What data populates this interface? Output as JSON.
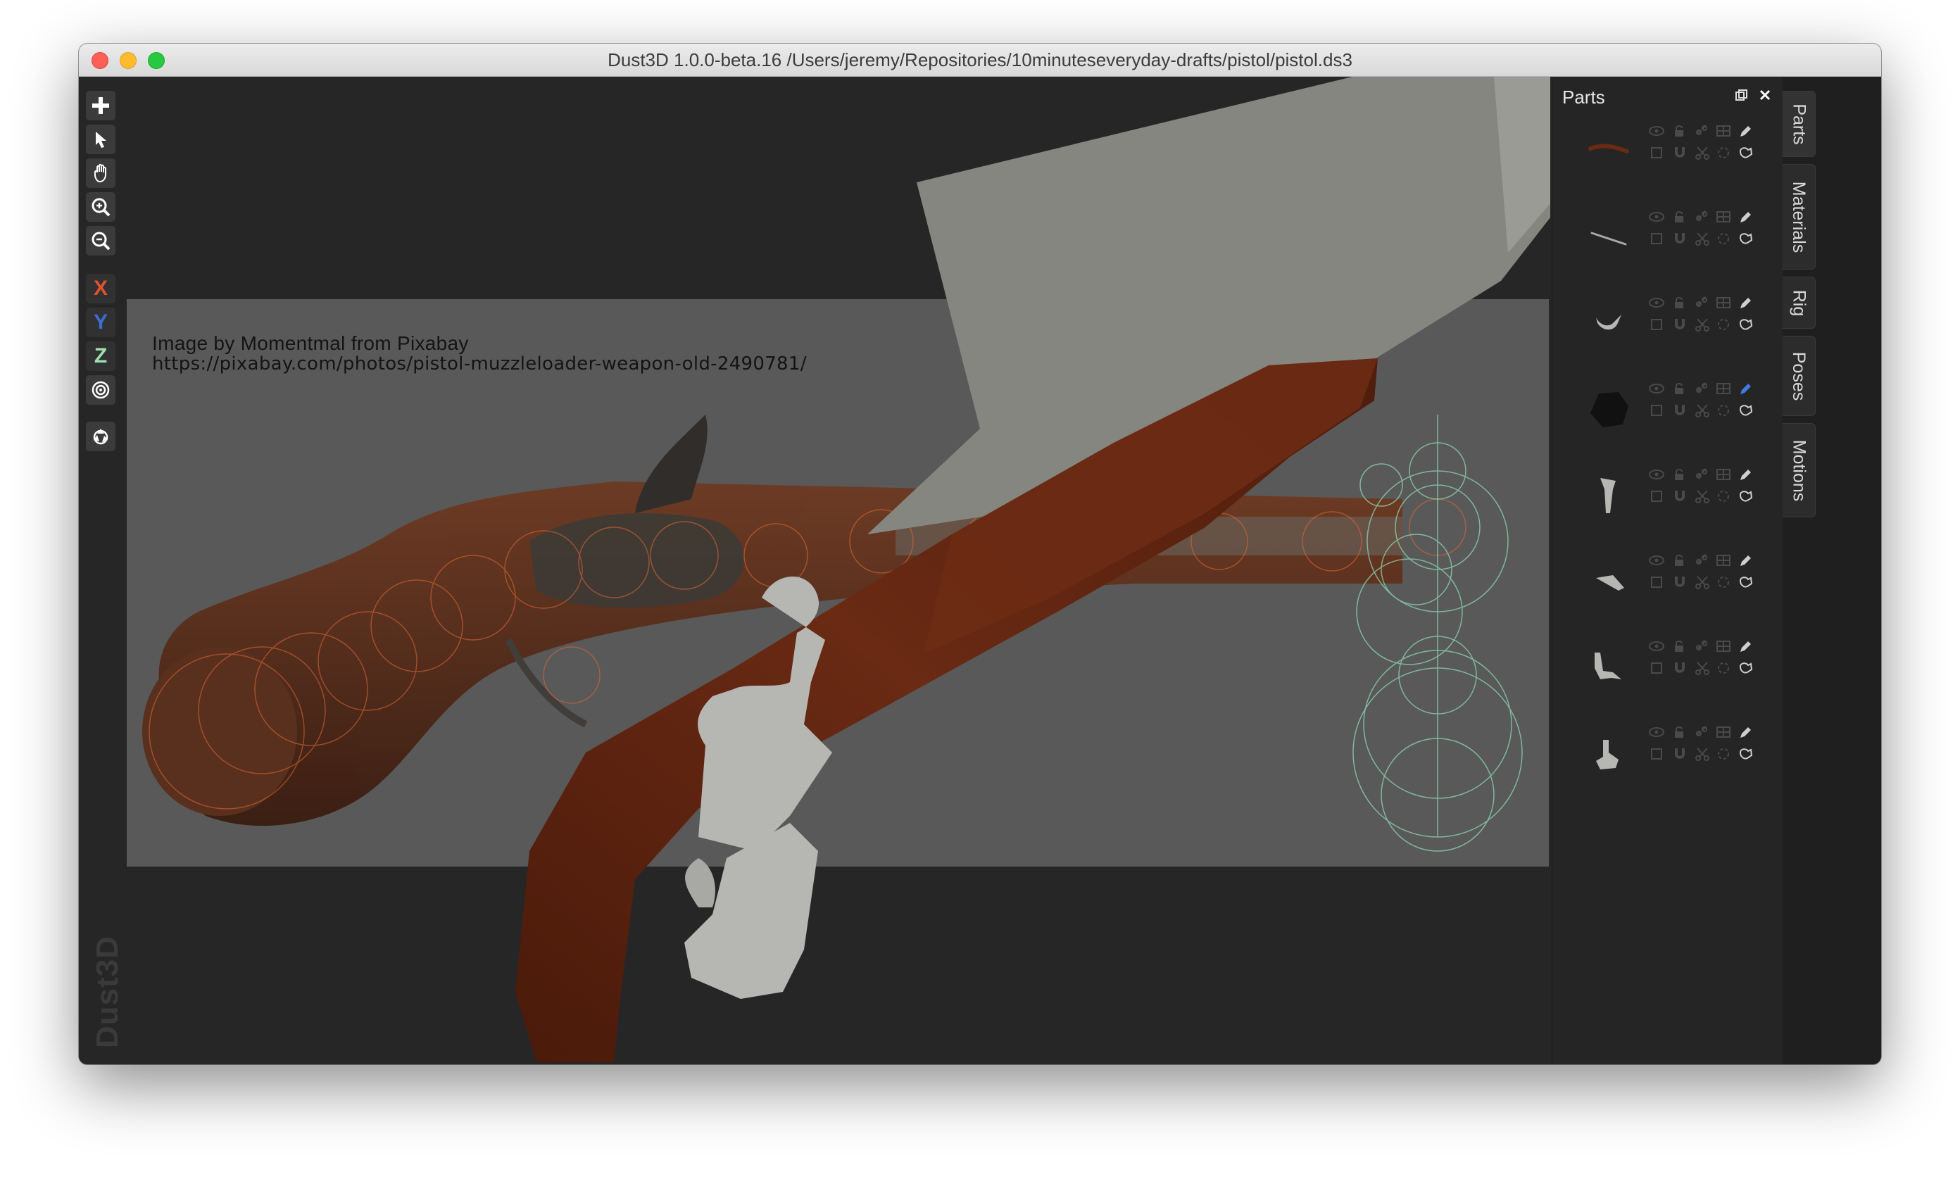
{
  "window": {
    "title": "Dust3D 1.0.0-beta.16 /Users/jeremy/Repositories/10minuteseveryday-drafts/pistol/pistol.ds3"
  },
  "reference_image": {
    "credit": "Image by Momentmal from Pixabay",
    "url": "https://pixabay.com/photos/pistol-muzzleloader-weapon-old-2490781/"
  },
  "toolbar": {
    "tools": [
      {
        "name": "add-icon"
      },
      {
        "name": "select-icon"
      },
      {
        "name": "pan-hand-icon"
      },
      {
        "name": "zoom-in-icon"
      },
      {
        "name": "zoom-out-icon"
      }
    ],
    "axes": [
      {
        "label": "X",
        "color": "#e0522e"
      },
      {
        "label": "Y",
        "color": "#3a6fd1"
      },
      {
        "label": "Z",
        "color": "#9ee0b0"
      }
    ],
    "extra": [
      "radius-icon",
      "regenerate-icon"
    ]
  },
  "watermark": "Dust3D",
  "parts_panel": {
    "title": "Parts",
    "parts": [
      {
        "thumbnail": "stock-curve",
        "selected_edit": false
      },
      {
        "thumbnail": "rod",
        "selected_edit": false
      },
      {
        "thumbnail": "hook",
        "selected_edit": false
      },
      {
        "thumbnail": "dark-sphere",
        "selected_edit": true
      },
      {
        "thumbnail": "hammer",
        "selected_edit": false
      },
      {
        "thumbnail": "flat-blade",
        "selected_edit": false
      },
      {
        "thumbnail": "trigger-guard",
        "selected_edit": false
      },
      {
        "thumbnail": "trigger",
        "selected_edit": false
      }
    ]
  },
  "side_tabs": [
    {
      "label": "Parts"
    },
    {
      "label": "Materials"
    },
    {
      "label": "Rig"
    },
    {
      "label": "Poses"
    },
    {
      "label": "Motions"
    }
  ],
  "colors": {
    "stock": "#5e2512",
    "metal": "#b4b4b0",
    "barrel": "#858680",
    "background": "#262626",
    "accent_blue": "#3f7be0"
  }
}
